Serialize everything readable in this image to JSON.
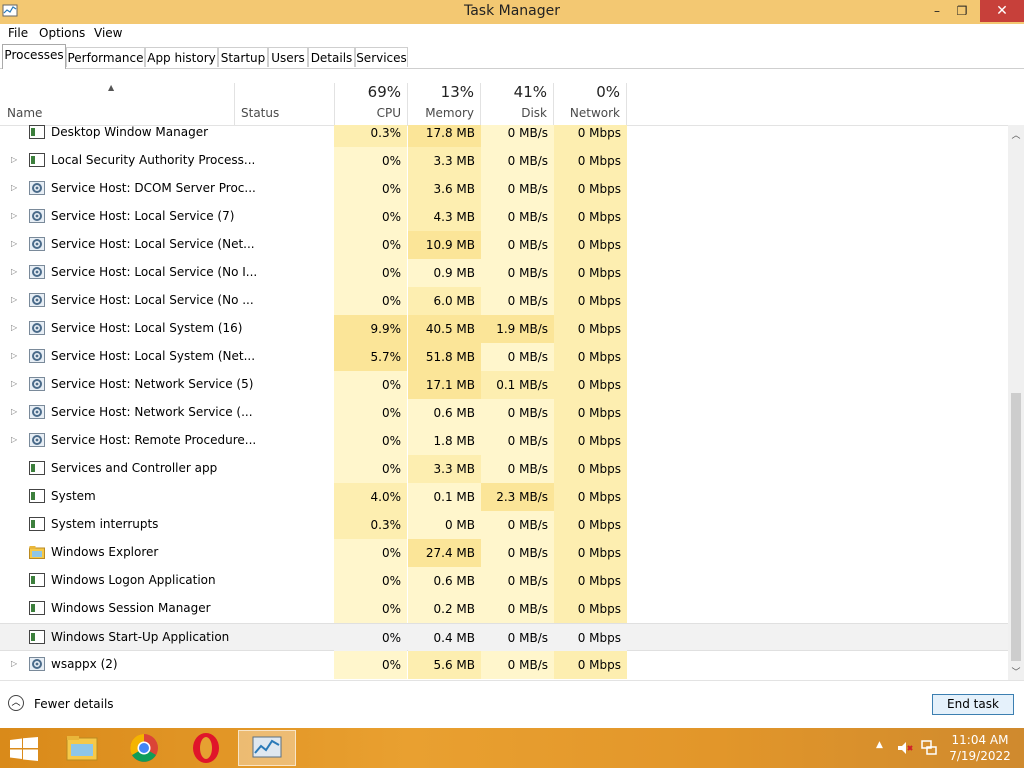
{
  "window": {
    "title": "Task Manager",
    "minimize": "–",
    "maximize": "❐",
    "close": "✕"
  },
  "menu": [
    "File",
    "Options",
    "View"
  ],
  "tabs": [
    "Processes",
    "Performance",
    "App history",
    "Startup",
    "Users",
    "Details",
    "Services"
  ],
  "active_tab": "Processes",
  "header": {
    "name": "Name",
    "status": "Status",
    "cpu": {
      "pct": "69%",
      "label": "CPU"
    },
    "memory": {
      "pct": "13%",
      "label": "Memory"
    },
    "disk": {
      "pct": "41%",
      "label": "Disk"
    },
    "network": {
      "pct": "0%",
      "label": "Network"
    }
  },
  "processes": [
    {
      "name": "Desktop Window Manager",
      "icon": "window-icon",
      "expandable": false,
      "cpu": "0.3%",
      "memory": "17.8 MB",
      "disk": "0 MB/s",
      "network": "0 Mbps"
    },
    {
      "name": "Local Security Authority Process...",
      "icon": "window-icon",
      "expandable": true,
      "cpu": "0%",
      "memory": "3.3 MB",
      "disk": "0 MB/s",
      "network": "0 Mbps"
    },
    {
      "name": "Service Host: DCOM Server Proc...",
      "icon": "gear-icon",
      "expandable": true,
      "cpu": "0%",
      "memory": "3.6 MB",
      "disk": "0 MB/s",
      "network": "0 Mbps"
    },
    {
      "name": "Service Host: Local Service (7)",
      "icon": "gear-icon",
      "expandable": true,
      "cpu": "0%",
      "memory": "4.3 MB",
      "disk": "0 MB/s",
      "network": "0 Mbps"
    },
    {
      "name": "Service Host: Local Service (Net...",
      "icon": "gear-icon",
      "expandable": true,
      "cpu": "0%",
      "memory": "10.9 MB",
      "disk": "0 MB/s",
      "network": "0 Mbps"
    },
    {
      "name": "Service Host: Local Service (No I...",
      "icon": "gear-icon",
      "expandable": true,
      "cpu": "0%",
      "memory": "0.9 MB",
      "disk": "0 MB/s",
      "network": "0 Mbps"
    },
    {
      "name": "Service Host: Local Service (No ...",
      "icon": "gear-icon",
      "expandable": true,
      "cpu": "0%",
      "memory": "6.0 MB",
      "disk": "0 MB/s",
      "network": "0 Mbps"
    },
    {
      "name": "Service Host: Local System (16)",
      "icon": "gear-icon",
      "expandable": true,
      "cpu": "9.9%",
      "memory": "40.5 MB",
      "disk": "1.9 MB/s",
      "network": "0 Mbps"
    },
    {
      "name": "Service Host: Local System (Net...",
      "icon": "gear-icon",
      "expandable": true,
      "cpu": "5.7%",
      "memory": "51.8 MB",
      "disk": "0 MB/s",
      "network": "0 Mbps"
    },
    {
      "name": "Service Host: Network Service (5)",
      "icon": "gear-icon",
      "expandable": true,
      "cpu": "0%",
      "memory": "17.1 MB",
      "disk": "0.1 MB/s",
      "network": "0 Mbps"
    },
    {
      "name": "Service Host: Network Service (...",
      "icon": "gear-icon",
      "expandable": true,
      "cpu": "0%",
      "memory": "0.6 MB",
      "disk": "0 MB/s",
      "network": "0 Mbps"
    },
    {
      "name": "Service Host: Remote Procedure...",
      "icon": "gear-icon",
      "expandable": true,
      "cpu": "0%",
      "memory": "1.8 MB",
      "disk": "0 MB/s",
      "network": "0 Mbps"
    },
    {
      "name": "Services and Controller app",
      "icon": "window-icon",
      "expandable": false,
      "cpu": "0%",
      "memory": "3.3 MB",
      "disk": "0 MB/s",
      "network": "0 Mbps"
    },
    {
      "name": "System",
      "icon": "window-icon",
      "expandable": false,
      "cpu": "4.0%",
      "memory": "0.1 MB",
      "disk": "2.3 MB/s",
      "network": "0 Mbps"
    },
    {
      "name": "System interrupts",
      "icon": "window-icon",
      "expandable": false,
      "cpu": "0.3%",
      "memory": "0 MB",
      "disk": "0 MB/s",
      "network": "0 Mbps"
    },
    {
      "name": "Windows Explorer",
      "icon": "folder-icon",
      "expandable": false,
      "cpu": "0%",
      "memory": "27.4 MB",
      "disk": "0 MB/s",
      "network": "0 Mbps"
    },
    {
      "name": "Windows Logon Application",
      "icon": "window-icon",
      "expandable": false,
      "cpu": "0%",
      "memory": "0.6 MB",
      "disk": "0 MB/s",
      "network": "0 Mbps"
    },
    {
      "name": "Windows Session Manager",
      "icon": "window-icon",
      "expandable": false,
      "cpu": "0%",
      "memory": "0.2 MB",
      "disk": "0 MB/s",
      "network": "0 Mbps"
    },
    {
      "name": "Windows Start-Up Application",
      "icon": "window-icon",
      "expandable": false,
      "selected": true,
      "cpu": "0%",
      "memory": "0.4 MB",
      "disk": "0 MB/s",
      "network": "0 Mbps"
    },
    {
      "name": "wsappx (2)",
      "icon": "gear-icon",
      "expandable": true,
      "cpu": "0%",
      "memory": "5.6 MB",
      "disk": "0 MB/s",
      "network": "0 Mbps"
    }
  ],
  "footer": {
    "fewer_details": "Fewer details",
    "end_task": "End task"
  },
  "taskbar": {
    "apps": [
      "file-explorer-icon",
      "chrome-icon",
      "opera-icon",
      "task-manager-icon"
    ],
    "active_app": "task-manager-icon",
    "time": "11:04 AM",
    "date": "7/19/2022"
  },
  "colors": {
    "titlebar": "#f3c872",
    "heat_light": "#fff6cc",
    "heat_mid": "#fdeeb0",
    "heat_strong": "#fbe598",
    "taskbar": "#e2962a",
    "close": "#c7403a"
  }
}
